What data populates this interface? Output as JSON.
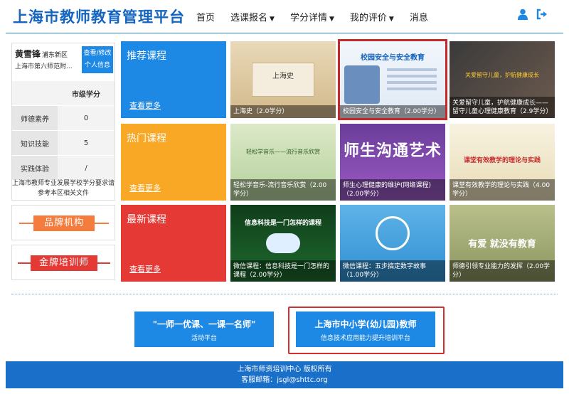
{
  "header": {
    "title": "上海市教师教育管理平台",
    "nav": [
      {
        "label": "首页",
        "dropdown": false
      },
      {
        "label": "选课报名",
        "dropdown": true
      },
      {
        "label": "学分详情",
        "dropdown": true
      },
      {
        "label": "我的评价",
        "dropdown": true
      },
      {
        "label": "消息",
        "dropdown": false
      }
    ],
    "icons": [
      "user-icon",
      "logout-icon"
    ]
  },
  "profile": {
    "name": "黄雪锋",
    "district": "浦东新区",
    "school": "上海市第六师范附...",
    "button_line1": "查看/修改",
    "button_line2": "个人信息",
    "table_header": "市级学分",
    "rows": [
      {
        "label": "师德素养",
        "value": "0"
      },
      {
        "label": "知识技能",
        "value": "5"
      },
      {
        "label": "实践体验",
        "value": "/"
      }
    ],
    "note": "上海市教师专业发展学校学分要求请参考本区相关文件"
  },
  "brands": {
    "brand_institution": "品牌机构",
    "gold_trainer": "金牌培训师"
  },
  "sections": {
    "recommended": {
      "title": "推荐课程",
      "more": "查看更多",
      "color": "#1e88e5"
    },
    "popular": {
      "title": "热门课程",
      "more": "查看更多",
      "color": "#f9a825"
    },
    "latest": {
      "title": "最新课程",
      "more": "查看更多",
      "color": "#e53935"
    }
  },
  "courses": {
    "recommended": [
      {
        "caption": "上海史（2.0学分）",
        "thumb_text": "上海史"
      },
      {
        "caption": "校园安全与安全教育（2.00学分）",
        "thumb_text": "校园安全与安全教育"
      },
      {
        "caption": "关爱留守儿童，护航健康成长——留守儿童心理健康教育（2.9学分）",
        "thumb_text": "关爱留守儿童，护航健康成长"
      }
    ],
    "popular": [
      {
        "caption": "轻松学音乐-流行音乐欣赏（2.00学分）",
        "thumb_text": "轻松学音乐——流行音乐欣赏"
      },
      {
        "caption": "师生心理健康的维护(网络课程)（2.00学分）",
        "thumb_text": "师生沟通艺术"
      },
      {
        "caption": "课堂有效教学的理论与实践（4.00学分）",
        "thumb_text": "课堂有效教学的理论与实践"
      }
    ],
    "latest": [
      {
        "caption": "微信课程：信息科技是一门怎样的课程（2.00学分）",
        "thumb_text": "信息科技是一门怎样的课程"
      },
      {
        "caption": "微信课程：五步搞定数字故事（1.00学分）",
        "thumb_text": ""
      },
      {
        "caption": "师德引领专业能力的发挥（2.00学分）",
        "thumb_text": "有爱 就没有教育"
      }
    ]
  },
  "promos": [
    {
      "main": "\"一师一优课、一课一名师\"",
      "sub": "活动平台"
    },
    {
      "main": "上海市中小学(幼儿园)教师",
      "sub": "信息技术应用能力提升培训平台"
    }
  ],
  "footer": {
    "line1": "上海市师资培训中心 版权所有",
    "line2": "客服邮箱：jsgl@shttc.org"
  },
  "colors": {
    "primary": "#1e88e5",
    "title": "#1565c0",
    "popular": "#f9a825",
    "latest": "#e53935",
    "brand_orange": "#f47c3c",
    "highlight": "#c62828"
  }
}
